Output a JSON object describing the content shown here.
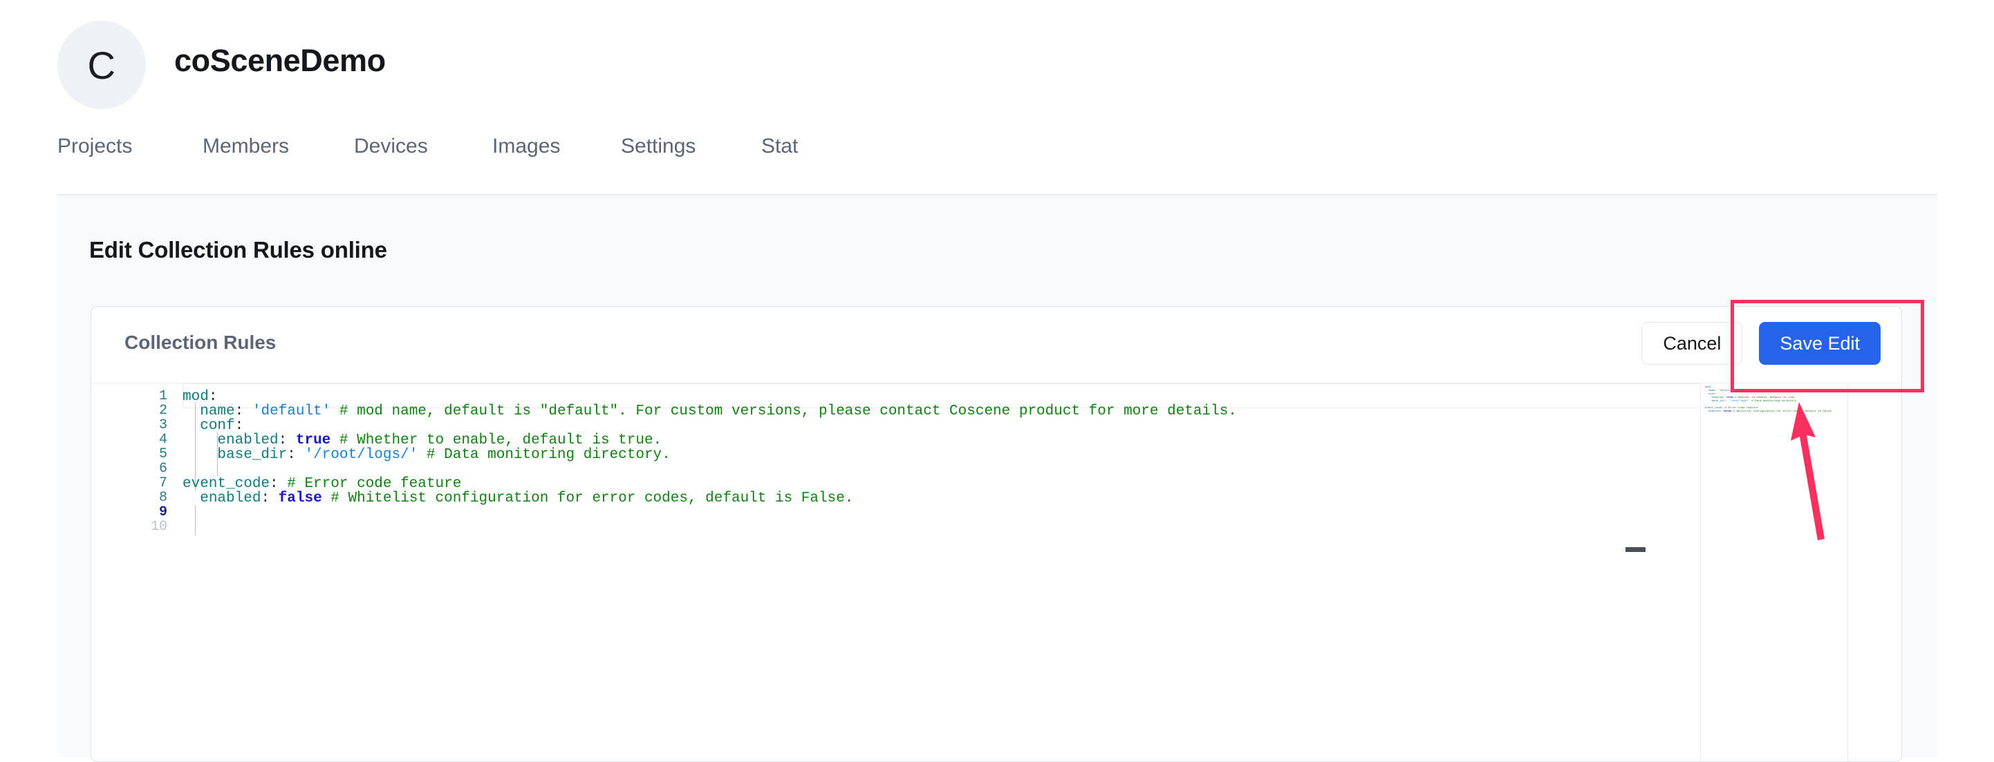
{
  "org": {
    "avatar_letter": "C",
    "name": "coSceneDemo"
  },
  "tabs": [
    {
      "id": "projects",
      "label": "Projects"
    },
    {
      "id": "members",
      "label": "Members"
    },
    {
      "id": "devices",
      "label": "Devices"
    },
    {
      "id": "images",
      "label": "Images"
    },
    {
      "id": "settings",
      "label": "Settings"
    },
    {
      "id": "stat",
      "label": "Stat"
    }
  ],
  "page": {
    "heading": "Edit Collection Rules online"
  },
  "card": {
    "title": "Collection Rules",
    "cancel_label": "Cancel",
    "save_label": "Save Edit"
  },
  "editor": {
    "language": "yaml",
    "active_line": 9,
    "line_numbers": [
      "1",
      "2",
      "3",
      "4",
      "5",
      "6",
      "7",
      "8",
      "9",
      "10"
    ],
    "lines": [
      {
        "n": "1",
        "text": "mod:"
      },
      {
        "n": "2",
        "text": "  name: 'default' # mod name, default is \"default\". For custom versions, please contact Coscene product for more details."
      },
      {
        "n": "3",
        "text": "  conf:"
      },
      {
        "n": "4",
        "text": "    enabled: true # Whether to enable, default is true."
      },
      {
        "n": "5",
        "text": "    base_dir: '/root/logs/' # Data monitoring directory."
      },
      {
        "n": "6",
        "text": ""
      },
      {
        "n": "7",
        "text": "event_code: # Error code feature"
      },
      {
        "n": "8",
        "text": "  enabled: false # Whitelist configuration for error codes, default is False."
      },
      {
        "n": "9",
        "text": ""
      },
      {
        "n": "10",
        "text": ""
      }
    ]
  },
  "annotation": {
    "type": "highlight-box-with-arrow",
    "target": "Save Edit",
    "color": "#f7305f"
  },
  "colors": {
    "accent_blue": "#2563e8",
    "annotation_pink": "#f7305f",
    "panel_bg": "#f7f9fb",
    "card_border": "#dfe3ea",
    "tab_text": "#5c6578",
    "yaml_key": "#0f7b7b",
    "yaml_string": "#1a7fd4",
    "yaml_bool": "#1a16cf",
    "yaml_comment": "#128012"
  }
}
